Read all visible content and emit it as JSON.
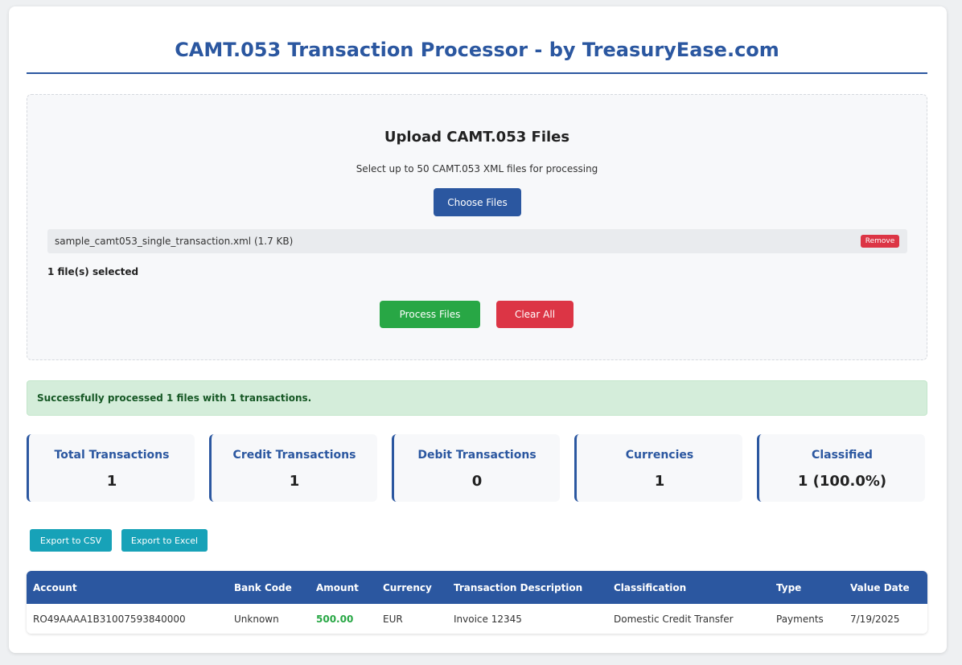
{
  "header": {
    "title": "CAMT.053 Transaction Processor - by TreasuryEase.com"
  },
  "upload": {
    "heading": "Upload CAMT.053 Files",
    "subtitle": "Select up to 50 CAMT.053 XML files for processing",
    "choose_label": "Choose Files",
    "files": [
      {
        "name": "sample_camt053_single_transaction.xml (1.7 KB)",
        "remove_label": "Remove"
      }
    ],
    "count_text": "1 file(s) selected",
    "process_label": "Process Files",
    "clear_label": "Clear All"
  },
  "status": {
    "message": "Successfully processed 1 files with 1 transactions."
  },
  "stats": [
    {
      "label": "Total Transactions",
      "value": "1"
    },
    {
      "label": "Credit Transactions",
      "value": "1"
    },
    {
      "label": "Debit Transactions",
      "value": "0"
    },
    {
      "label": "Currencies",
      "value": "1"
    },
    {
      "label": "Classified",
      "value": "1 (100.0%)"
    }
  ],
  "export": {
    "csv_label": "Export to CSV",
    "excel_label": "Export to Excel"
  },
  "table": {
    "columns": [
      "Account",
      "Bank Code",
      "Amount",
      "Currency",
      "Transaction Description",
      "Classification",
      "Type",
      "Value Date"
    ],
    "rows": [
      [
        "RO49AAAA1B31007593840000",
        "Unknown",
        "500.00",
        "EUR",
        "Invoice 12345",
        "Domestic Credit Transfer",
        "Payments",
        "7/19/2025"
      ]
    ]
  },
  "colors": {
    "primary": "#2b57a0",
    "success": "#28a745",
    "danger": "#dc3545",
    "info": "#17a2b8"
  }
}
